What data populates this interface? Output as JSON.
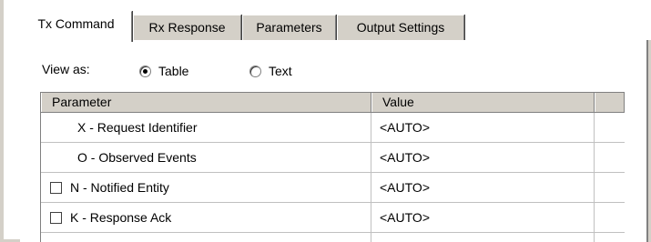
{
  "tabs": [
    {
      "label": "Tx Command",
      "active": true
    },
    {
      "label": "Rx Response",
      "active": false
    },
    {
      "label": "Parameters",
      "active": false
    },
    {
      "label": "Output Settings",
      "active": false
    }
  ],
  "view_as": {
    "label": "View as:",
    "options": [
      {
        "label": "Table",
        "selected": true
      },
      {
        "label": "Text",
        "selected": false
      }
    ]
  },
  "grid": {
    "columns": [
      "Parameter",
      "Value",
      ""
    ],
    "rows": [
      {
        "parameter": "X - Request Identifier",
        "value": "<AUTO>",
        "has_checkbox": false,
        "checked": false
      },
      {
        "parameter": "O - Observed Events",
        "value": "<AUTO>",
        "has_checkbox": false,
        "checked": false
      },
      {
        "parameter": "N - Notified Entity",
        "value": "<AUTO>",
        "has_checkbox": true,
        "checked": false
      },
      {
        "parameter": "K - Response Ack",
        "value": "<AUTO>",
        "has_checkbox": true,
        "checked": false
      }
    ]
  },
  "colors": {
    "face": "#d4d0c8",
    "shadow": "#808080",
    "grid_line": "#c0c0c0",
    "window": "#ffffff"
  }
}
